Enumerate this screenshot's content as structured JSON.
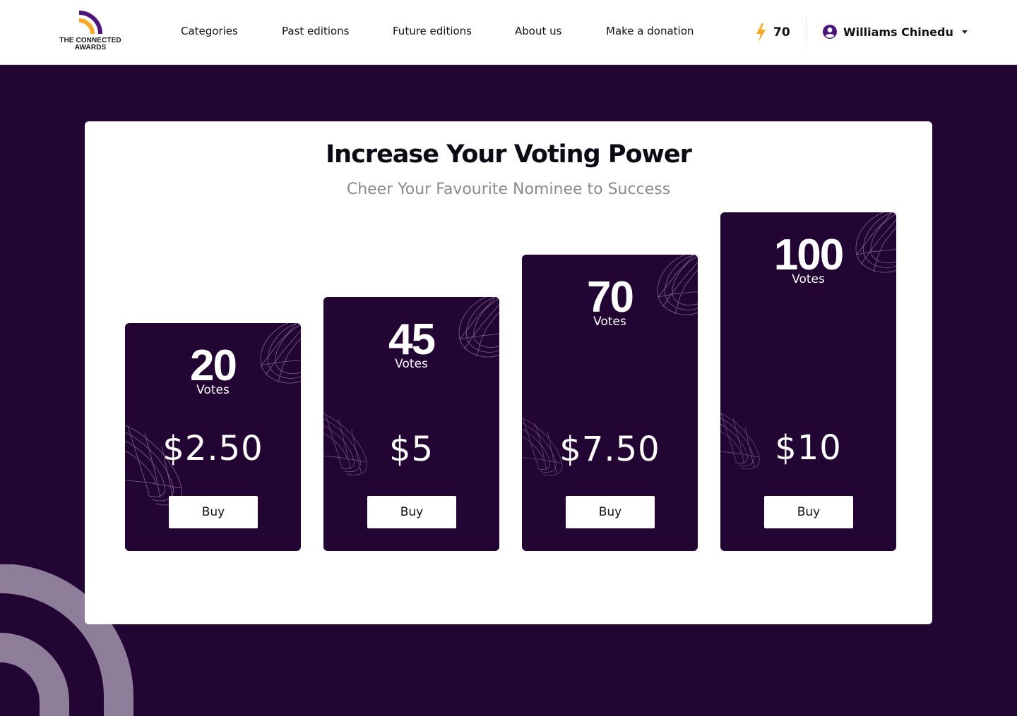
{
  "brand": {
    "logo_line1": "THE CONNECTED",
    "logo_line2": "AWARDS",
    "accent": "#F5A623",
    "primary": "#4B1579",
    "background": "#220533"
  },
  "nav": {
    "items": [
      {
        "label": "Categories"
      },
      {
        "label": "Past editions"
      },
      {
        "label": "Future editions"
      },
      {
        "label": "About us"
      },
      {
        "label": "Make a donation"
      }
    ]
  },
  "account": {
    "votes_icon": "lightning-icon",
    "votes_balance": "70",
    "user_icon": "user-circle-icon",
    "user_name": "Williams Chinedu",
    "menu_icon": "caret-down-icon"
  },
  "page": {
    "title": "Increase Your Voting Power",
    "subtitle": "Cheer Your Favourite Nominee to Success"
  },
  "bundles": [
    {
      "votes": "20",
      "unit": "Votes",
      "price": "$2.50",
      "button": "Buy"
    },
    {
      "votes": "45",
      "unit": "Votes",
      "price": "$5",
      "button": "Buy"
    },
    {
      "votes": "70",
      "unit": "Votes",
      "price": "$7.50",
      "button": "Buy"
    },
    {
      "votes": "100",
      "unit": "Votes",
      "price": "$10",
      "button": "Buy"
    }
  ]
}
